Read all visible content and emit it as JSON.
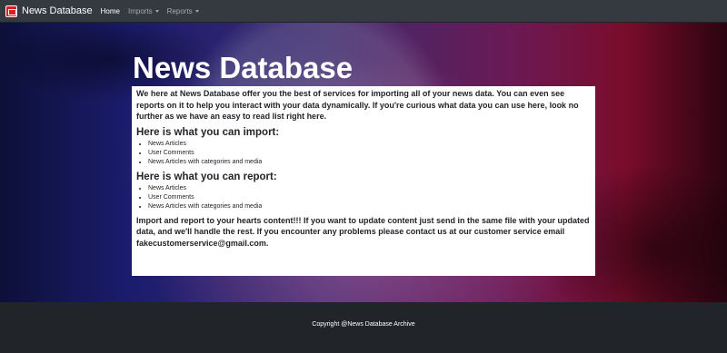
{
  "navbar": {
    "brand": "News Database",
    "links": [
      {
        "label": "Home",
        "active": true,
        "dropdown": false
      },
      {
        "label": "Imports",
        "active": false,
        "dropdown": true
      },
      {
        "label": "Reports",
        "active": false,
        "dropdown": true
      }
    ]
  },
  "hero": {
    "title": "News Database"
  },
  "content": {
    "intro": "We here at News Database offer you the best of services for importing all of your news data. You can even see reports on it to help you interact with your data dynamically. If you're curious what data you can use here, look no further as we have an easy to read list right here.",
    "import_title": "Here is what you can import:",
    "import_items": [
      "News Articles",
      "User Comments",
      "News Articles with categories and media"
    ],
    "report_title": "Here is what you can report:",
    "report_items": [
      "News Articles",
      "User Comments",
      "News Articles with categories and media"
    ],
    "outro": "Import and report to your hearts content!!! If you want to update content just send in the same file with your updated data, and we'll handle the rest. If you encounter any problems please contact us at our customer service email fakecustomerservice@gmail.com."
  },
  "footer": {
    "text": "Copyright @News Database Archive"
  },
  "colors": {
    "navbar_bg": "#343a40",
    "footer_bg": "#212529",
    "logo_red": "#d8202a"
  }
}
